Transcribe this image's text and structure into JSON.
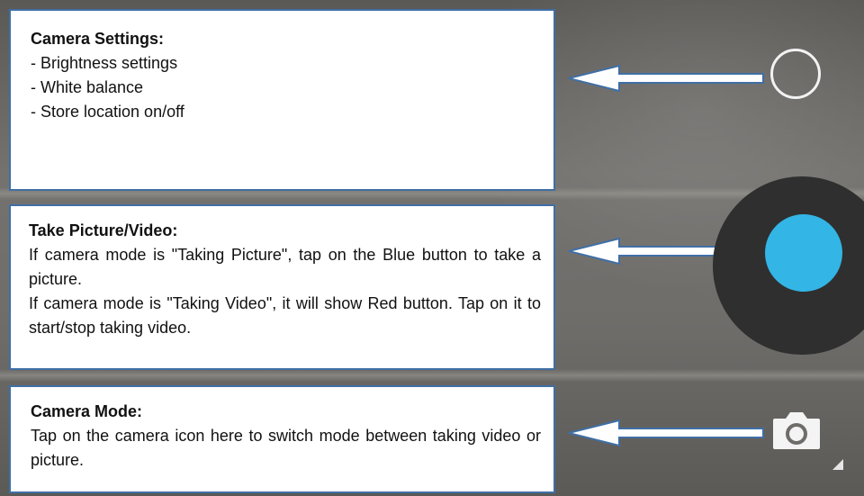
{
  "colors": {
    "accent": "#33b5e5",
    "panel_border": "#3f6fa6",
    "background": "#6e6c69",
    "shutter_ring": "#2f2f2f"
  },
  "panels": [
    {
      "title": "Camera Settings:",
      "items": [
        "- Brightness settings",
        "- White balance",
        "- Store location on/off"
      ]
    },
    {
      "title": "Take Picture/Video:",
      "paragraphs": [
        "If camera mode is \"Taking Picture\", tap on the Blue button to take a picture.",
        "If camera mode is \"Taking Video\", it will show Red button. Tap on it to start/stop taking video."
      ]
    },
    {
      "title": "Camera Mode:",
      "paragraphs": [
        "Tap on the camera icon here to switch mode between taking video or picture."
      ]
    }
  ],
  "controls": {
    "settings_icon": "circle-outline-icon",
    "shutter_icon": "shutter-button-icon",
    "mode_icon": "camera-icon"
  }
}
